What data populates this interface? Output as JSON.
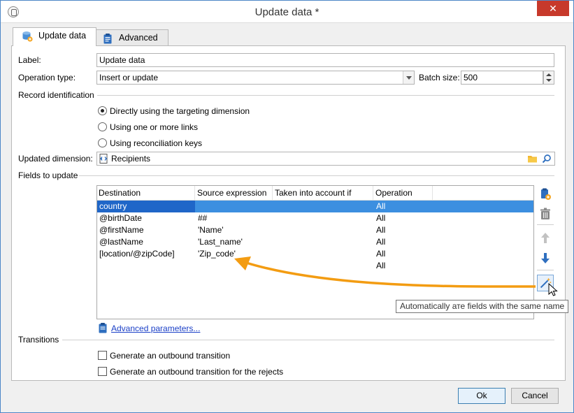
{
  "window": {
    "title": "Update data *",
    "close_glyph": "✕"
  },
  "tabs": [
    {
      "label": "Update data",
      "icon": "database-update-icon"
    },
    {
      "label": "Advanced",
      "icon": "clipboard-icon"
    }
  ],
  "form": {
    "label_caption": "Label:",
    "label_value": "Update data",
    "operation_type_caption": "Operation type:",
    "operation_type_value": "Insert or update",
    "batch_size_caption": "Batch size:",
    "batch_size_value": "500",
    "record_identification_caption": "Record identification",
    "radios": [
      {
        "label": "Directly using the targeting dimension",
        "selected": true
      },
      {
        "label": "Using one or more links",
        "selected": false
      },
      {
        "label": "Using reconciliation keys",
        "selected": false
      }
    ],
    "updated_dimension_caption": "Updated dimension:",
    "updated_dimension_value": "Recipients",
    "fields_to_update_caption": "Fields to update"
  },
  "grid": {
    "columns": [
      "Destination",
      "Source expression",
      "Taken into account if",
      "Operation"
    ],
    "rows": [
      {
        "destination": "country",
        "source": "",
        "condition": "",
        "operation": "All",
        "selected": true
      },
      {
        "destination": "@birthDate",
        "source": "##",
        "condition": "",
        "operation": "All",
        "selected": false
      },
      {
        "destination": "@firstName",
        "source": "'Name'",
        "condition": "",
        "operation": "All",
        "selected": false
      },
      {
        "destination": "@lastName",
        "source": "'Last_name'",
        "condition": "",
        "operation": "All",
        "selected": false
      },
      {
        "destination": "[location/@zipCode]",
        "source": "'Zip_code'",
        "condition": "",
        "operation": "All",
        "selected": false
      },
      {
        "destination": "",
        "source": "",
        "condition": "",
        "operation": "All",
        "selected": false
      }
    ]
  },
  "tooltip": "Automatically ате fields with the same name",
  "advanced_parameters_link": "Advanced parameters...",
  "transitions": {
    "caption": "Transitions",
    "checkboxes": [
      {
        "label": "Generate an outbound transition",
        "checked": false
      },
      {
        "label": "Generate an outbound transition for the rejects",
        "checked": false
      }
    ]
  },
  "footer": {
    "ok_label": "Ok",
    "cancel_label": "Cancel"
  },
  "colors": {
    "accent_arrow": "#f39c12",
    "selection": "#3c8fe0",
    "close_red": "#c7392b",
    "link": "#1a3fc7"
  }
}
